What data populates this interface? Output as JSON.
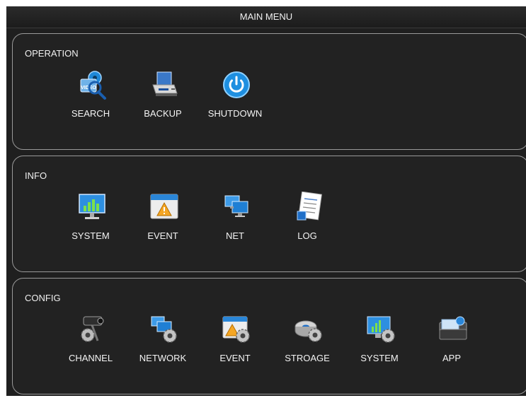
{
  "window": {
    "title": "MAIN MENU"
  },
  "operation": {
    "title": "OPERATION",
    "items": [
      {
        "label": "SEARCH",
        "icon": "video-search-icon",
        "icon_text": "VIDEO"
      },
      {
        "label": "BACKUP",
        "icon": "backup-drive-icon"
      },
      {
        "label": "SHUTDOWN",
        "icon": "power-icon"
      }
    ]
  },
  "info": {
    "title": "INFO",
    "items": [
      {
        "label": "SYSTEM",
        "icon": "system-monitor-icon"
      },
      {
        "label": "EVENT",
        "icon": "event-warning-icon"
      },
      {
        "label": "NET",
        "icon": "network-monitors-icon"
      },
      {
        "label": "LOG",
        "icon": "log-document-icon"
      }
    ]
  },
  "config": {
    "title": "CONFIG",
    "items": [
      {
        "label": "CHANNEL",
        "icon": "camera-gear-icon"
      },
      {
        "label": "NETWORK",
        "icon": "network-gear-icon"
      },
      {
        "label": "EVENT",
        "icon": "event-gear-icon"
      },
      {
        "label": "STROAGE",
        "icon": "storage-gear-icon"
      },
      {
        "label": "SYSTEM",
        "icon": "system-gear-icon"
      },
      {
        "label": "APP",
        "icon": "app-folder-icon"
      }
    ]
  },
  "colors": {
    "background": "#1f1f1f",
    "panel_border": "#9a9a9a",
    "text": "#f0f0f0",
    "accent_blue": "#1e8fe0"
  }
}
